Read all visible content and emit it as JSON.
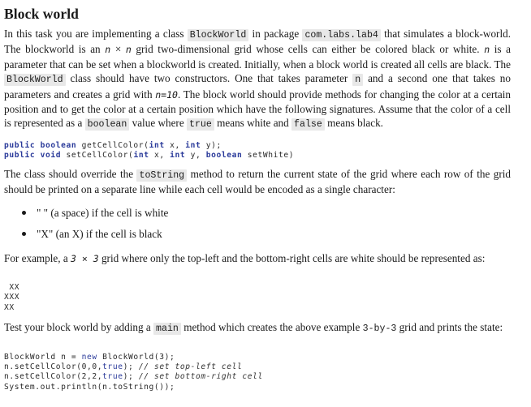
{
  "title": "Block world",
  "intro": {
    "t1": "In this task you are implementing a class ",
    "class_name": "BlockWorld",
    "t2": " in package ",
    "package": "com.labs.lab4",
    "t3": " that simulates a block-world. The blockworld is an ",
    "n1": "n",
    "times": " × ",
    "n2": "n",
    "t4": " grid two-dimensional grid whose cells can either be colored black or white. ",
    "n3": "n",
    "t5": " is a parameter that can be set when a blockworld is created. Initially, when a block world is created all cells are black. The ",
    "class_name2": "BlockWorld",
    "t6": " class should have two constructors. One that takes parameter ",
    "param": "n",
    "t7": " and a second one that takes no parameters and creates a grid with ",
    "default_n": "n=10",
    "t8": ". The block world should provide methods for changing the color at a certain position and to get the color at a certain position which have the following signatures. Assume that the color of a cell is represented as a ",
    "type_boolean": "boolean",
    "t9": " value where ",
    "val_true": "true",
    "t10": " means white and ",
    "val_false": "false",
    "t11": " means black."
  },
  "signatures": [
    {
      "kw1": "public",
      "kw2": "boolean",
      "rest": " getCellColor(",
      "p1t": "int",
      "p1": " x, ",
      "p2t": "int",
      "p2": " y);"
    },
    {
      "kw1": "public",
      "kw2": "void",
      "rest": " setCellColor(",
      "p1t": "int",
      "p1": " x, ",
      "p2t": "int",
      "p2": " y, ",
      "p3t": "boolean",
      "p3": " setWhite)"
    }
  ],
  "tostring_para": {
    "t1": "The class should override the ",
    "method": "toString",
    "t2": " method to return the current state of the grid where each row of the grid should be printed on a separate line while each cell would be encoded as a single character:"
  },
  "encoding_list": [
    "\" \" (a space) if the cell is white",
    "\"X\" (an X) if the cell is black"
  ],
  "example_para": {
    "t1": "For example, a ",
    "dim": "3 × 3",
    "t2": " grid where only the top-left and the bottom-right cells are white should be represented as:"
  },
  "example_output": " XX\nXXX\nXX ",
  "test_para": {
    "t1": "Test your block world by adding a ",
    "method": "main",
    "t2": " method which creates the above example ",
    "size": "3-by-3",
    "t3": " grid and prints the state:"
  },
  "test_code": [
    {
      "a": "BlockWorld n = ",
      "kw": "new",
      "b": " BlockWorld(3);",
      "c": ""
    },
    {
      "a": "n.setCellColor(0,0,",
      "kw": "true",
      "b": "); ",
      "c": "// set top-left cell"
    },
    {
      "a": "n.setCellColor(2,2,",
      "kw": "true",
      "b": "); ",
      "c": "// set bottom-right cell"
    },
    {
      "a": "System.out.println(n.toString());",
      "kw": "",
      "b": "",
      "c": ""
    }
  ]
}
